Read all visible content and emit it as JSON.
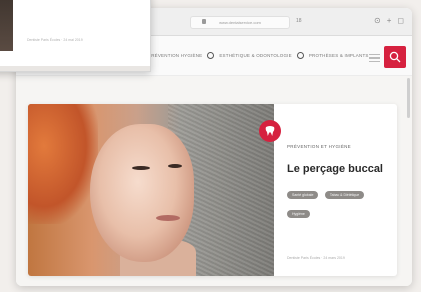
{
  "browser": {
    "address": "www.dentalservice.com",
    "tab_count": "18"
  },
  "nav": {
    "items": [
      "PRÉVENTION HYGIÈNE",
      "ESTHÉTIQUE & ODONTOLOGIE",
      "PROTHÈSES & IMPLANTS"
    ]
  },
  "article": {
    "category": "PRÉVENTION ET HYGIÈNE",
    "title": "Le perçage buccal",
    "tags": [
      "Santé globale",
      "Tabac & Diététique",
      "Hygiène"
    ],
    "meta": "Dentiste Paris Écoles · 24 mars 2019"
  },
  "small_window": {
    "meta": "Dentiste Paris Écoles · 24 mai 2019"
  },
  "colors": {
    "accent": "#d6213f",
    "tag": "#8e8b88",
    "title": "#2a2a2a"
  }
}
